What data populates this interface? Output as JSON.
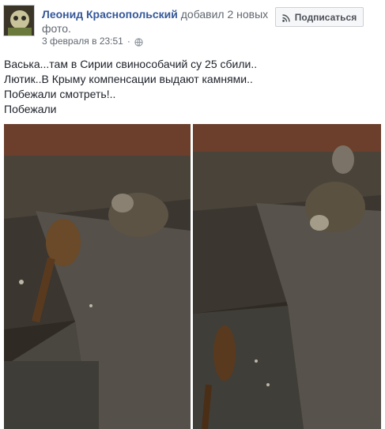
{
  "post": {
    "author": "Леонид Краснопольский",
    "action": "добавил 2 новых фото.",
    "timestamp": "3 февраля в 23:51",
    "separator": "·",
    "privacy_icon": "globe-icon",
    "lines": [
      "Васька...там в Сирии свинособачий су 25 сбили..",
      "Лютик..В Крыму компенсации выдают камнями..",
      "Побежали смотреть!..",
      "Побежали"
    ]
  },
  "follow_button": {
    "label": "Подписаться",
    "icon": "rss-icon"
  },
  "colors": {
    "link": "#365899",
    "meta": "#616770",
    "text": "#1d2129",
    "button_bg": "#f6f7f9",
    "button_border": "#ced0d4"
  }
}
